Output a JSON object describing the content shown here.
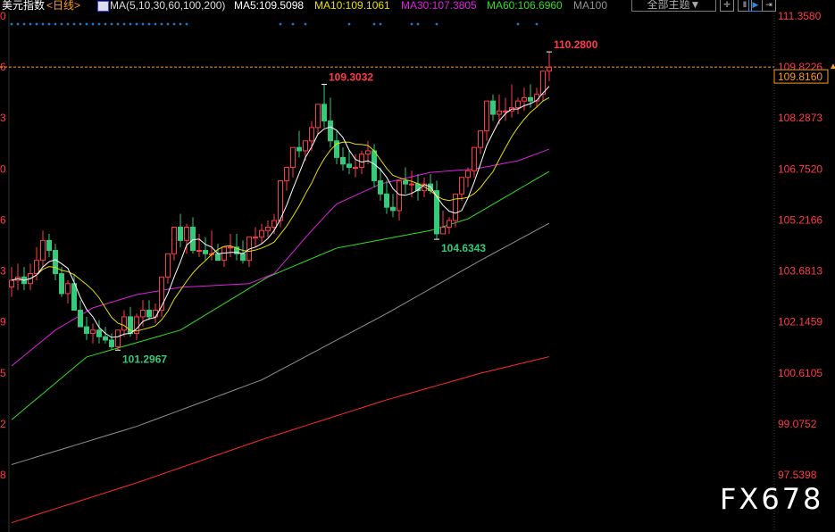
{
  "header": {
    "symbol": "美元指数",
    "period": "<日线>",
    "ma_params": "MA(5,10,30,60,100,200)",
    "ma5": "MA5:109.5098",
    "ma10": "MA10:109.1061",
    "ma30": "MA30:107.3805",
    "ma60": "MA60:106.6960",
    "ma100": "MA100",
    "theme_button": "全部主题▼",
    "tool_icons": [
      "crosshair-icon",
      "interval-icon",
      "play-icon",
      "expand-right-icon"
    ]
  },
  "colors": {
    "up": "#ff3a4a",
    "down": "#35c97a",
    "ma5": "#ffffff",
    "ma10": "#e6e000",
    "ma30": "#e020e0",
    "ma60": "#33dd22",
    "ma100": "#909090",
    "ma200": "#ff2a2a",
    "axis_text": "#ff3a4a",
    "current": "#ff9a20",
    "signal": "#1e78c8"
  },
  "chart_data": {
    "type": "candlestick",
    "ylim": [
      97.5398,
      111.358
    ],
    "y_ticks": [
      "111.3580",
      "109.8226",
      "108.2873",
      "106.7520",
      "105.2166",
      "103.6813",
      "102.1459",
      "100.6105",
      "99.0752",
      "97.5398"
    ],
    "left_tick_fragments": [
      "0",
      "6",
      "3",
      "0",
      "6",
      "3",
      "9",
      "5",
      "2",
      "8"
    ],
    "open": [
      103.2,
      103.4,
      103.5,
      103.3,
      103.6,
      104.0,
      104.6,
      104.3,
      103.6,
      103.0,
      103.3,
      102.5,
      102.0,
      101.8,
      101.9,
      101.7,
      101.6,
      101.4,
      101.9,
      102.3,
      101.8,
      102.3,
      102.5,
      102.3,
      102.5,
      103.5,
      104.2,
      105.0,
      104.6,
      105.0,
      104.3,
      104.3,
      104.2,
      104.2,
      104.0,
      104.4,
      104.4,
      104.2,
      104.0,
      104.7,
      104.7,
      104.9,
      105.0,
      105.2,
      106.4,
      106.8,
      107.4,
      107.3,
      107.6,
      108.0,
      108.7,
      108.2,
      107.6,
      107.1,
      106.9,
      106.8,
      106.8,
      107.2,
      107.3,
      106.4,
      106.0,
      105.6,
      105.5,
      106.4,
      106.3,
      106.3,
      106.1,
      106.3,
      106.1,
      104.8,
      105.0,
      105.2,
      106.0,
      106.5,
      106.7,
      107.4,
      107.9,
      108.8,
      108.4,
      108.5,
      108.5,
      108.6,
      108.8,
      108.9,
      108.8,
      109.0,
      109.7
    ],
    "high": [
      103.8,
      103.9,
      103.8,
      103.9,
      104.4,
      104.9,
      104.8,
      104.5,
      103.8,
      103.4,
      103.6,
      102.8,
      102.3,
      102.1,
      102.2,
      102.0,
      101.8,
      101.9,
      102.5,
      102.6,
      102.4,
      102.8,
      102.8,
      102.7,
      102.9,
      103.9,
      104.6,
      105.4,
      105.1,
      105.3,
      104.8,
      104.7,
      104.9,
      104.5,
      104.3,
      104.8,
      104.8,
      104.6,
      104.3,
      105.0,
      105.1,
      105.2,
      105.4,
      105.7,
      106.8,
      107.3,
      107.9,
      107.6,
      108.2,
      108.6,
      109.3032,
      108.9,
      107.9,
      107.4,
      107.3,
      107.2,
      107.3,
      107.6,
      107.5,
      106.8,
      106.4,
      106.0,
      106.1,
      106.8,
      106.7,
      106.6,
      106.5,
      106.6,
      106.4,
      105.5,
      105.3,
      105.5,
      106.3,
      106.8,
      107.2,
      107.9,
      108.3,
      109.0,
      109.0,
      108.9,
      109.3,
      108.9,
      109.2,
      109.3,
      109.2,
      109.6,
      110.28
    ],
    "low": [
      102.9,
      103.1,
      103.1,
      103.1,
      103.4,
      103.8,
      104.1,
      103.4,
      102.9,
      102.7,
      103.0,
      102.0,
      101.6,
      101.5,
      101.5,
      101.5,
      101.3,
      101.2967,
      101.7,
      101.7,
      101.6,
      102.0,
      102.2,
      102.1,
      102.3,
      103.3,
      104.0,
      104.4,
      104.2,
      104.2,
      104.1,
      104.0,
      104.0,
      104.0,
      103.8,
      104.1,
      104.0,
      103.9,
      103.8,
      104.4,
      104.5,
      104.7,
      104.8,
      105.0,
      106.1,
      106.5,
      107.1,
      107.0,
      107.3,
      107.8,
      108.0,
      107.4,
      106.9,
      106.7,
      106.6,
      106.5,
      106.6,
      106.9,
      106.2,
      105.8,
      105.4,
      105.3,
      105.2,
      106.0,
      105.9,
      105.8,
      105.9,
      106.0,
      104.6343,
      104.8,
      104.8,
      105.0,
      105.8,
      106.2,
      106.5,
      107.2,
      107.6,
      108.2,
      108.1,
      108.2,
      108.3,
      108.4,
      108.5,
      108.6,
      108.6,
      108.8,
      109.4
    ],
    "close": [
      103.4,
      103.5,
      103.3,
      103.6,
      104.0,
      104.6,
      104.3,
      103.6,
      103.0,
      103.3,
      102.5,
      102.0,
      101.8,
      101.9,
      101.7,
      101.6,
      101.4,
      101.9,
      102.3,
      101.8,
      102.3,
      102.5,
      102.3,
      102.5,
      103.5,
      104.2,
      105.0,
      104.6,
      105.0,
      104.3,
      104.3,
      104.2,
      104.2,
      104.0,
      104.4,
      104.4,
      104.2,
      104.0,
      104.7,
      104.7,
      104.9,
      105.0,
      105.2,
      106.4,
      106.8,
      107.4,
      107.3,
      107.6,
      108.0,
      108.7,
      108.2,
      107.6,
      107.1,
      106.9,
      106.8,
      106.8,
      107.2,
      107.3,
      106.4,
      106.0,
      105.6,
      105.5,
      106.4,
      106.3,
      106.3,
      106.1,
      106.3,
      106.1,
      104.8,
      105.0,
      105.2,
      106.0,
      106.5,
      106.7,
      107.4,
      107.9,
      108.8,
      108.4,
      108.5,
      108.5,
      108.6,
      108.8,
      108.9,
      108.8,
      109.0,
      109.7,
      109.816
    ],
    "ma_lines": {
      "ma30": {
        "idx": [
          0,
          7,
          13,
          20,
          27,
          38,
          42,
          48,
          52,
          59,
          67,
          74,
          81,
          86
        ],
        "val": [
          100.82,
          101.9,
          102.57,
          102.97,
          103.19,
          103.3,
          103.6,
          104.9,
          105.7,
          106.3,
          106.65,
          106.75,
          107.0,
          107.35
        ]
      },
      "ma60": {
        "idx": [
          0,
          12,
          27,
          41,
          52,
          67,
          73,
          78,
          86
        ],
        "val": [
          99.2,
          101.09,
          101.9,
          103.5,
          104.37,
          104.9,
          105.25,
          105.8,
          106.68
        ]
      },
      "ma100": {
        "idx": [
          0,
          20,
          40,
          60,
          75,
          86
        ],
        "val": [
          97.85,
          99.0,
          100.4,
          102.4,
          104.0,
          105.12
        ]
      },
      "ma200": {
        "idx": [
          0,
          20,
          40,
          60,
          75,
          86
        ],
        "val": [
          96.1,
          97.3,
          98.6,
          99.8,
          100.6,
          101.1
        ]
      }
    },
    "annotations": [
      {
        "text": "110.2800",
        "idx": 86,
        "price": 110.28,
        "kind": "high"
      },
      {
        "text": "109.3032",
        "idx": 50,
        "price": 109.3032,
        "kind": "high"
      },
      {
        "text": "104.6343",
        "idx": 68,
        "price": 104.6343,
        "kind": "low"
      },
      {
        "text": "101.2967",
        "idx": 17,
        "price": 101.2967,
        "kind": "low"
      }
    ],
    "current_price": "109.8160",
    "reference_line": 109.8226,
    "signal_dot_indices": [
      0,
      1,
      2,
      3,
      4,
      5,
      6,
      7,
      8,
      9,
      10,
      11,
      12,
      13,
      14,
      15,
      16,
      17,
      18,
      19,
      20,
      21,
      22,
      23,
      24,
      25,
      26,
      27,
      28,
      43,
      45,
      47,
      54,
      58,
      59,
      64,
      65,
      68,
      81,
      84
    ]
  },
  "watermark": "FX678"
}
